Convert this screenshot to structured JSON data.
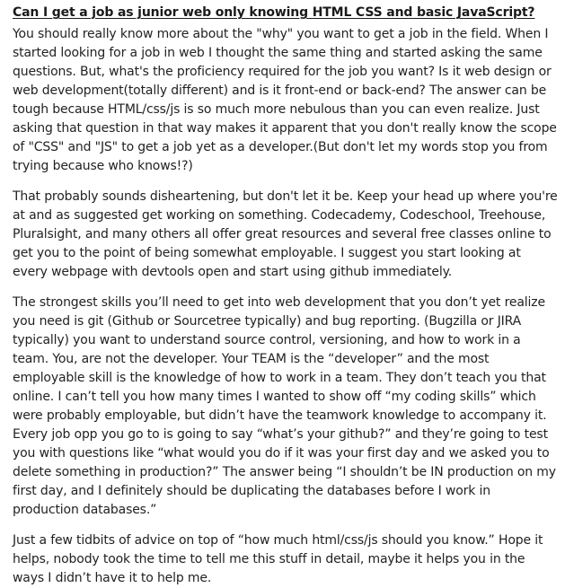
{
  "question": {
    "title": "Can I get a job as junior web only knowing HTML CSS and basic JavaScript?"
  },
  "answer": {
    "paragraphs": [
      "You should really know more about the \"why\" you want to get a job in the field. When I started looking for a job in web I thought the same thing and started asking the same questions. But, what's the proficiency required for the job you want? Is it web design or web development(totally different) and is it front-end or back-end? The answer can be tough because HTML/css/js is so much more nebulous than you can even realize. Just asking that question in that way makes it apparent that you don't really know the scope of \"CSS\" and \"JS\" to get a job yet as a developer.(But don't let my words stop you from trying because who knows!?)",
      "That probably sounds disheartening, but don't let it be. Keep your head up where you're at and as suggested get working on something. Codecademy, Codeschool, Treehouse, Pluralsight, and many others all offer great resources and several free classes online to get you to the point of being somewhat employable. I suggest you start looking at every webpage with devtools open and start using github immediately.",
      "The strongest skills you’ll need to get into web development that you don’t yet realize you need is git (Github or Sourcetree typically) and bug reporting. (Bugzilla or JIRA typically) you want to understand source control, versioning, and how to work in a team. You, are not the developer. Your TEAM is the “developer” and the most employable skill is the knowledge of how to work in a team. They don’t teach you that online. I can’t tell you how many times I wanted to show off “my coding skills” which were probably employable, but didn’t have the teamwork knowledge to accompany it. Every job opp you go to is going to say “what’s your github?” and they’re going to test you with questions like “what would you do if it was your first day and we asked you to delete something in production?” The answer being “I shouldn’t be IN production on my first day, and I definitely should be duplicating the databases before I work in production databases.”",
      "Just a few tidbits of advice on top of “how much html/css/js should you know.” Hope it helps, nobody took the time to tell me this stuff in detail, maybe it helps you in the ways I didn’t have it to help me."
    ]
  }
}
